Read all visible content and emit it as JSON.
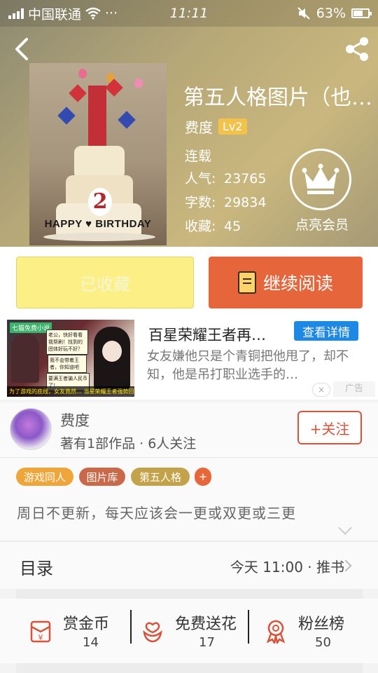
{
  "status_bar": {
    "carrier": "中国联通",
    "more": "···",
    "time": "11:11",
    "battery": "63%",
    "battery_level": 0.63
  },
  "book": {
    "title": "第五人格图片（也…",
    "author": "费度",
    "level": "Lv2",
    "status": "连载",
    "popularity_label": "人气:",
    "popularity": "23765",
    "words_label": "字数:",
    "words": "29834",
    "favorites_label": "收藏:",
    "favorites": "45",
    "cover_text": "HAPPY ♥ BIRTHDAY",
    "cover_number": "2"
  },
  "vip": {
    "label": "点亮会员"
  },
  "actions": {
    "favorited_label": "已收藏",
    "continue_label": "继续阅读"
  },
  "ad": {
    "image_tag": "七猫免费小说",
    "image_caption": "为了游戏的底线，女友竟然… 当星荣耀王者强势回归，分分钟带你上王者",
    "bubble1": "老公，快好看看我帮刷！找到的团体好玩不好？",
    "bubble2": "我不会带着王者，你知道吧",
    "bubble3": "要满王者骗人民币了！",
    "title": "百星荣耀王者再…",
    "cta": "查看详情",
    "desc": "女友嫌他只是个青铜把他甩了，却不知，他是吊打职业选手的…",
    "label": "广告",
    "close": "×"
  },
  "author_card": {
    "name": "费度",
    "stats": "著有1部作品 · 6人关注",
    "follow": "+关注"
  },
  "tags": [
    {
      "label": "游戏同人",
      "color": "#f0a53a"
    },
    {
      "label": "图片库",
      "color": "#c9694a"
    },
    {
      "label": "第五人格",
      "color": "#c4a24a"
    }
  ],
  "tags_add": "+",
  "tag_add_color": "#e8673a",
  "description": "周日不更新，每天应该会一更或双更或三更",
  "toc": {
    "label": "目录",
    "update": "今天 11:00 · 推书"
  },
  "stats": [
    {
      "label": "赏金币",
      "value": "14",
      "icon": "red-envelope-icon"
    },
    {
      "label": "免费送花",
      "value": "17",
      "icon": "flower-icon"
    },
    {
      "label": "粉丝榜",
      "value": "50",
      "icon": "medal-icon"
    }
  ],
  "colors": {
    "accent": "#e7653a",
    "favorite_bg": "#fbef86",
    "ad_button": "#1e88e5",
    "icon_red": "#d9533a"
  }
}
